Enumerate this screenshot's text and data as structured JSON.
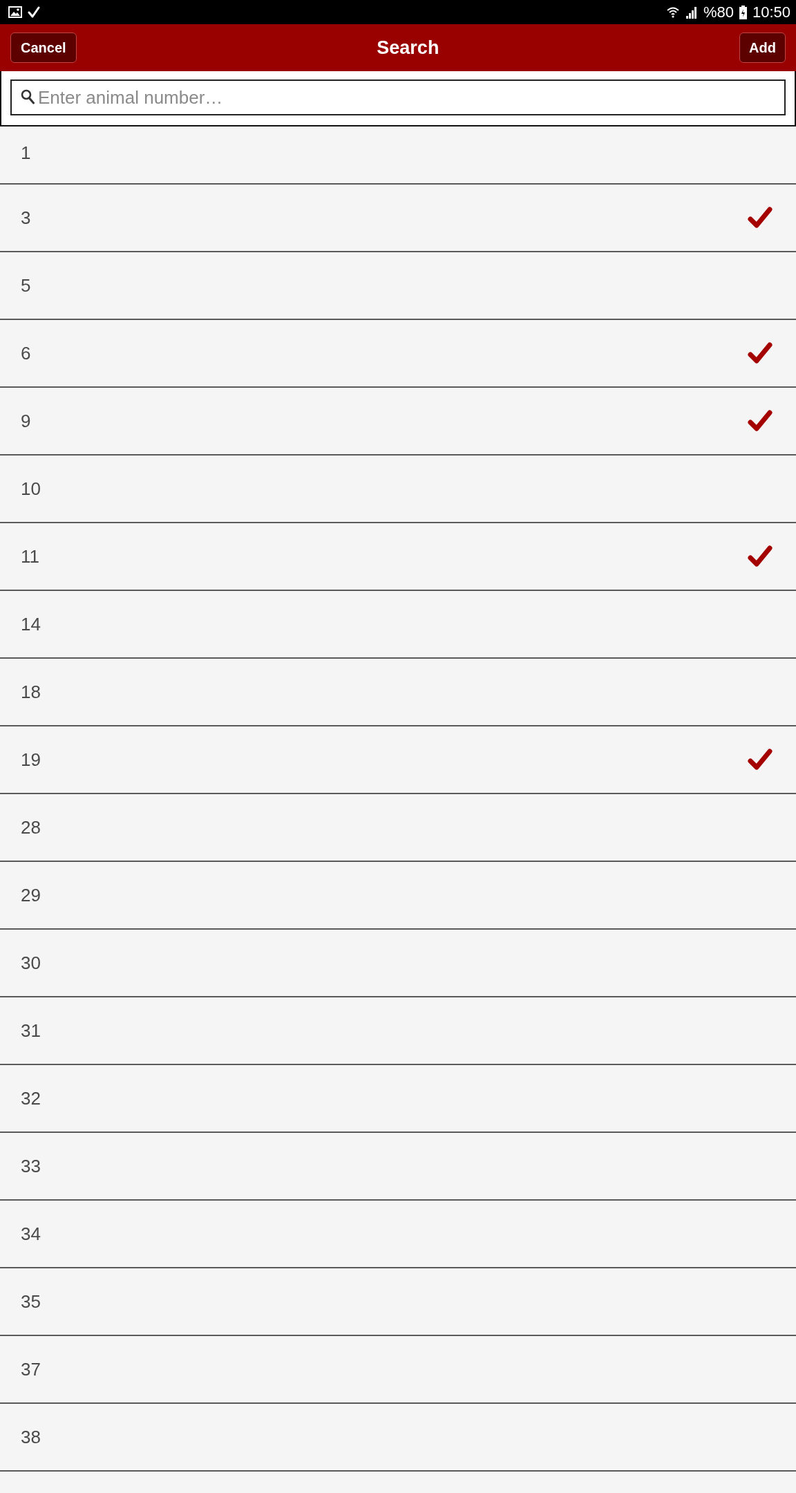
{
  "status_bar": {
    "battery": "%80",
    "time": "10:50"
  },
  "header": {
    "left_button": "Cancel",
    "title": "Search",
    "right_button": "Add"
  },
  "search": {
    "placeholder": "Enter animal number…"
  },
  "animals": [
    {
      "number": "1",
      "checked": false
    },
    {
      "number": "3",
      "checked": true
    },
    {
      "number": "5",
      "checked": false
    },
    {
      "number": "6",
      "checked": true
    },
    {
      "number": "9",
      "checked": true
    },
    {
      "number": "10",
      "checked": false
    },
    {
      "number": "11",
      "checked": true
    },
    {
      "number": "14",
      "checked": false
    },
    {
      "number": "18",
      "checked": false
    },
    {
      "number": "19",
      "checked": true
    },
    {
      "number": "28",
      "checked": false
    },
    {
      "number": "29",
      "checked": false
    },
    {
      "number": "30",
      "checked": false
    },
    {
      "number": "31",
      "checked": false
    },
    {
      "number": "32",
      "checked": false
    },
    {
      "number": "33",
      "checked": false
    },
    {
      "number": "34",
      "checked": false
    },
    {
      "number": "35",
      "checked": false
    },
    {
      "number": "37",
      "checked": false
    },
    {
      "number": "38",
      "checked": false
    }
  ]
}
